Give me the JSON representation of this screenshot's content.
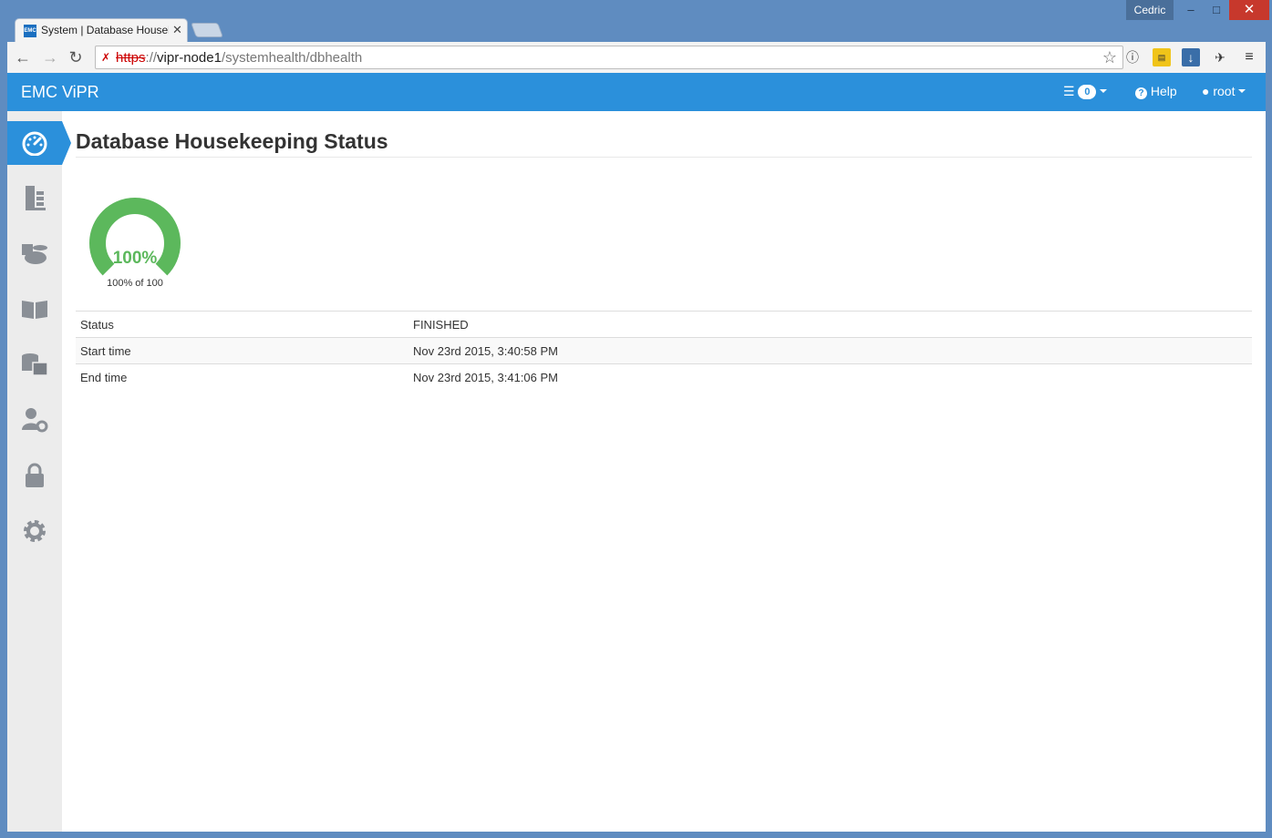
{
  "browser": {
    "user": "Cedric",
    "tab_title": "System | Database Housekeeping",
    "url_scheme": "https",
    "url_sep": "://",
    "url_host": "vipr-node1",
    "url_path": "/systemhealth/dbhealth",
    "tab_favicon_text": "EMC"
  },
  "appbar": {
    "brand": "EMC ViPR",
    "notifications_count": "0",
    "help_label": "Help",
    "user_label": "root"
  },
  "sidebar": {
    "items": [
      {
        "icon": "dashboard-icon",
        "active": true
      },
      {
        "icon": "server-rack-icon",
        "active": false
      },
      {
        "icon": "cloud-storage-icon",
        "active": false
      },
      {
        "icon": "catalog-book-icon",
        "active": false
      },
      {
        "icon": "storage-folder-icon",
        "active": false
      },
      {
        "icon": "user-settings-icon",
        "active": false
      },
      {
        "icon": "lock-icon",
        "active": false
      },
      {
        "icon": "gear-icon",
        "active": false
      }
    ]
  },
  "main": {
    "title": "Database Housekeeping Status",
    "gauge": {
      "percent": 100,
      "value_label": "100%",
      "caption": "100% of 100",
      "color": "#5cb85c"
    },
    "details": [
      {
        "key": "Status",
        "value": "FINISHED"
      },
      {
        "key": "Start time",
        "value": "Nov 23rd 2015, 3:40:58 PM"
      },
      {
        "key": "End time",
        "value": "Nov 23rd 2015, 3:41:06 PM"
      }
    ]
  },
  "colors": {
    "accent": "#2b90db",
    "success": "#5cb85c"
  }
}
